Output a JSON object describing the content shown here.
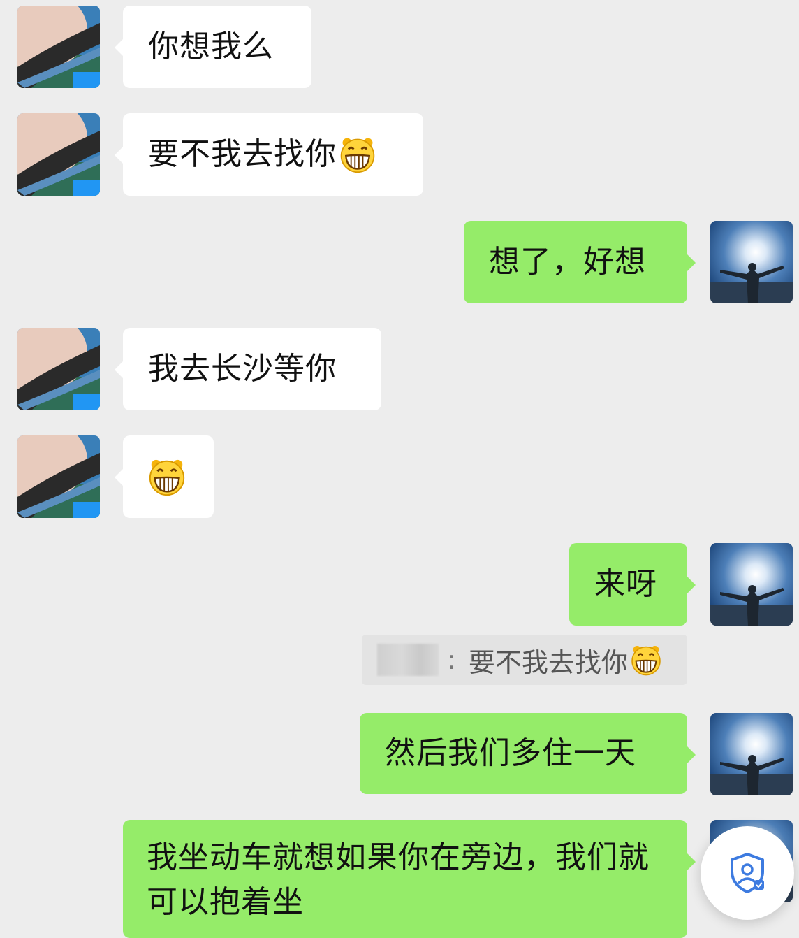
{
  "chat": {
    "messages": [
      {
        "side": "in",
        "text": "你想我么"
      },
      {
        "side": "in",
        "text": "要不我去找你",
        "emoji": "grinning-face-emoji"
      },
      {
        "side": "out",
        "text": "想了，好想"
      },
      {
        "side": "in",
        "text": "我去长沙等你"
      },
      {
        "side": "in",
        "text": "",
        "emoji": "grinning-face-emoji"
      },
      {
        "side": "out",
        "text": "来呀"
      },
      {
        "side": "out",
        "text": "然后我们多住一天"
      },
      {
        "side": "out",
        "text": "我坐动车就想如果你在旁边，我们就可以抱着坐"
      }
    ],
    "quote": {
      "separator": ":",
      "text": "要不我去找你",
      "emoji": "grinning-face-emoji"
    }
  },
  "avatars": {
    "contact": "hat-avatar",
    "self": "arms-raised-sunset-avatar"
  },
  "floating_button": {
    "icon": "shield-user-icon"
  },
  "colors": {
    "background": "#ededed",
    "incoming_bubble": "#ffffff",
    "outgoing_bubble": "#95ec69",
    "quote_bg": "#e3e3e3"
  }
}
